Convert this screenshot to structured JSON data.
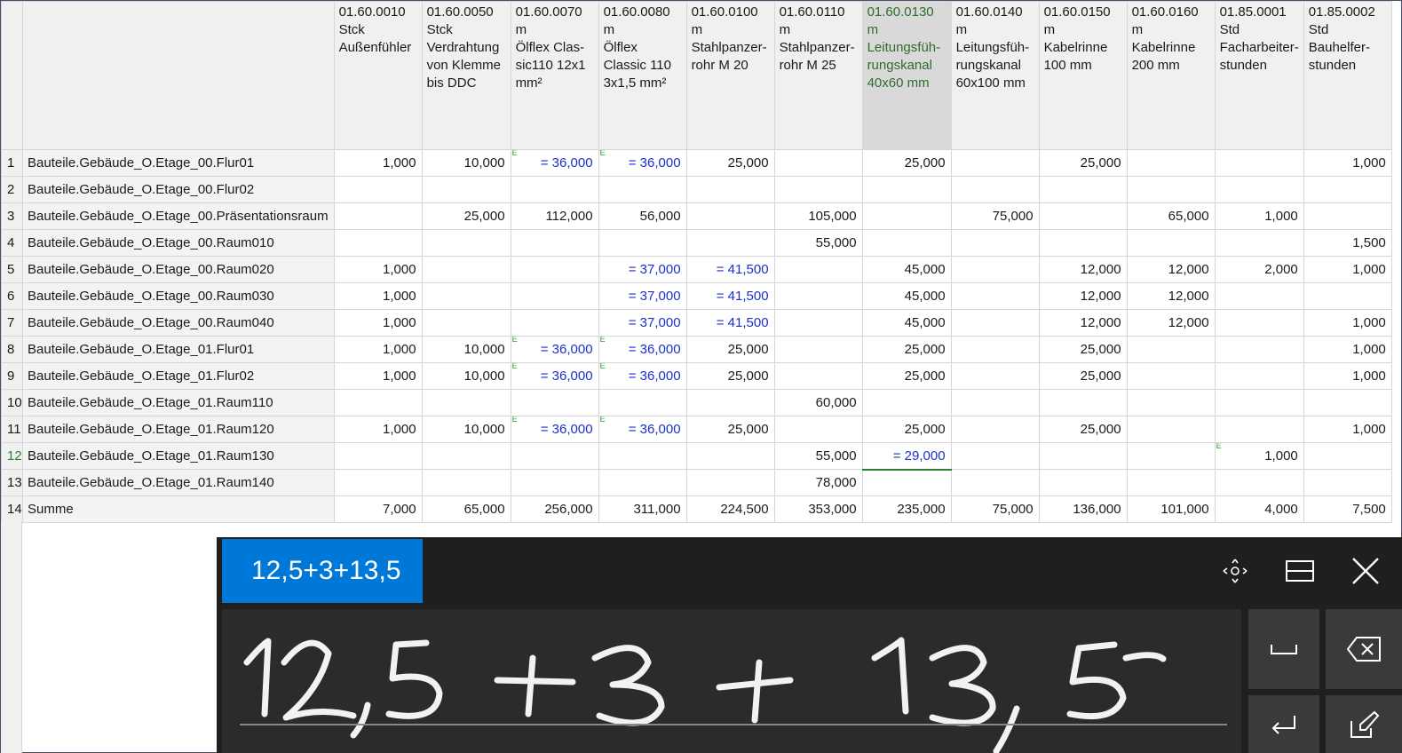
{
  "columns": [
    {
      "code": "01.60.0010",
      "unit": "Stck",
      "desc": "Außenfühler"
    },
    {
      "code": "01.60.0050",
      "unit": "Stck",
      "desc": "Verdrahtung von Klemme bis DDC"
    },
    {
      "code": "01.60.0070",
      "unit": "m",
      "desc": "Ölflex Clas-sic110 12x1 mm²"
    },
    {
      "code": "01.60.0080",
      "unit": "m",
      "desc": "Ölflex Classic 110 3x1,5 mm²"
    },
    {
      "code": "01.60.0100",
      "unit": "m",
      "desc": "Stahlpanzer-rohr M 20"
    },
    {
      "code": "01.60.0110",
      "unit": "m",
      "desc": "Stahlpanzer-rohr M 25"
    },
    {
      "code": "01.60.0130",
      "unit": "m",
      "desc": "Leitungsfüh-rungskanal 40x60 mm"
    },
    {
      "code": "01.60.0140",
      "unit": "m",
      "desc": "Leitungsfüh-rungskanal 60x100 mm"
    },
    {
      "code": "01.60.0150",
      "unit": "m",
      "desc": "Kabelrinne 100 mm"
    },
    {
      "code": "01.60.0160",
      "unit": "m",
      "desc": "Kabelrinne 200 mm"
    },
    {
      "code": "01.85.0001",
      "unit": "Std",
      "desc": "Facharbeiter-stunden"
    },
    {
      "code": "01.85.0002",
      "unit": "Std",
      "desc": "Bauhelfer-stunden"
    }
  ],
  "rows": [
    {
      "n": "1",
      "name": "Bauteile.Gebäude_O.Etage_00.Flur01",
      "cells": [
        "1,000",
        "10,000",
        "= 36,000",
        "= 36,000",
        "25,000",
        "",
        "25,000",
        "",
        "25,000",
        "",
        "",
        "1,000"
      ]
    },
    {
      "n": "2",
      "name": "Bauteile.Gebäude_O.Etage_00.Flur02",
      "cells": [
        "",
        "",
        "",
        "",
        "",
        "",
        "",
        "",
        "",
        "",
        "",
        ""
      ]
    },
    {
      "n": "3",
      "name": "Bauteile.Gebäude_O.Etage_00.Präsentationsraum",
      "cells": [
        "",
        "25,000",
        "112,000",
        "56,000",
        "",
        "105,000",
        "",
        "75,000",
        "",
        "65,000",
        "1,000",
        ""
      ]
    },
    {
      "n": "4",
      "name": "Bauteile.Gebäude_O.Etage_00.Raum010",
      "cells": [
        "",
        "",
        "",
        "",
        "",
        "55,000",
        "",
        "",
        "",
        "",
        "",
        "1,500"
      ]
    },
    {
      "n": "5",
      "name": "Bauteile.Gebäude_O.Etage_00.Raum020",
      "cells": [
        "1,000",
        "",
        "",
        "= 37,000",
        "= 41,500",
        "",
        "45,000",
        "",
        "12,000",
        "12,000",
        "2,000",
        "1,000"
      ]
    },
    {
      "n": "6",
      "name": "Bauteile.Gebäude_O.Etage_00.Raum030",
      "cells": [
        "1,000",
        "",
        "",
        "= 37,000",
        "= 41,500",
        "",
        "45,000",
        "",
        "12,000",
        "12,000",
        "",
        ""
      ]
    },
    {
      "n": "7",
      "name": "Bauteile.Gebäude_O.Etage_00.Raum040",
      "cells": [
        "1,000",
        "",
        "",
        "= 37,000",
        "= 41,500",
        "",
        "45,000",
        "",
        "12,000",
        "12,000",
        "",
        "1,000"
      ]
    },
    {
      "n": "8",
      "name": "Bauteile.Gebäude_O.Etage_01.Flur01",
      "cells": [
        "1,000",
        "10,000",
        "= 36,000",
        "= 36,000",
        "25,000",
        "",
        "25,000",
        "",
        "25,000",
        "",
        "",
        "1,000"
      ]
    },
    {
      "n": "9",
      "name": "Bauteile.Gebäude_O.Etage_01.Flur02",
      "cells": [
        "1,000",
        "10,000",
        "= 36,000",
        "= 36,000",
        "25,000",
        "",
        "25,000",
        "",
        "25,000",
        "",
        "",
        "1,000"
      ]
    },
    {
      "n": "10",
      "name": "Bauteile.Gebäude_O.Etage_01.Raum110",
      "cells": [
        "",
        "",
        "",
        "",
        "",
        "60,000",
        "",
        "",
        "",
        "",
        "",
        ""
      ]
    },
    {
      "n": "11",
      "name": "Bauteile.Gebäude_O.Etage_01.Raum120",
      "cells": [
        "1,000",
        "10,000",
        "= 36,000",
        "= 36,000",
        "25,000",
        "",
        "25,000",
        "",
        "25,000",
        "",
        "",
        "1,000"
      ]
    },
    {
      "n": "12",
      "name": "Bauteile.Gebäude_O.Etage_01.Raum130",
      "cells": [
        "",
        "",
        "",
        "",
        "",
        "55,000",
        "= 29,000",
        "",
        "",
        "",
        "1,000",
        ""
      ]
    },
    {
      "n": "13",
      "name": "Bauteile.Gebäude_O.Etage_01.Raum140",
      "cells": [
        "",
        "",
        "",
        "",
        "",
        "78,000",
        "",
        "",
        "",
        "",
        "",
        ""
      ]
    },
    {
      "n": "14",
      "name": "Summe",
      "cells": [
        "7,000",
        "65,000",
        "256,000",
        "311,000",
        "224,500",
        "353,000",
        "235,000",
        "75,000",
        "136,000",
        "101,000",
        "4,000",
        "7,500"
      ]
    }
  ],
  "e_marker": "E",
  "handwriting": {
    "candidate": "12,5+3+13,5",
    "ink_text": "12,5 + 3 + 13,5",
    "icons": [
      "move-icon",
      "dock-icon",
      "close-icon",
      "space-icon",
      "backspace-icon",
      "enter-icon",
      "edit-icon"
    ]
  }
}
